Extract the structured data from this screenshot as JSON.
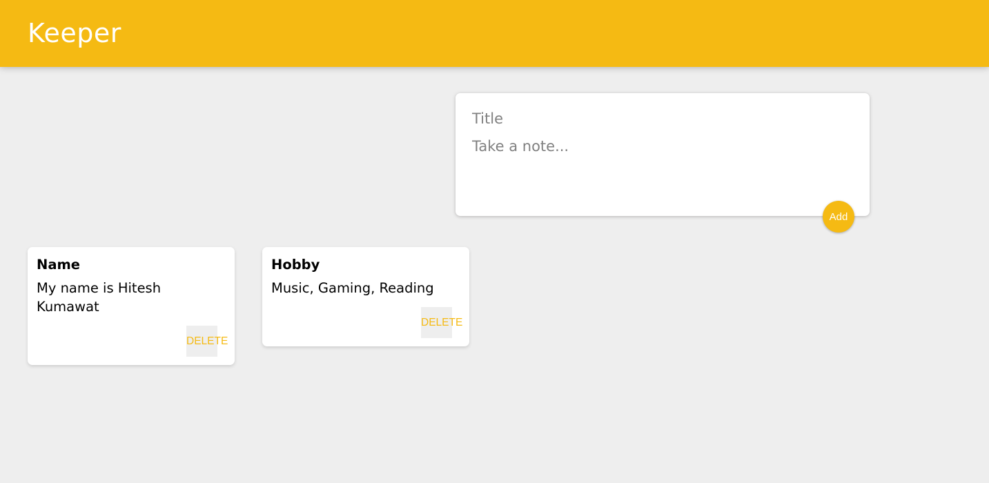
{
  "header": {
    "title": "Keeper"
  },
  "create_note": {
    "title_placeholder": "Title",
    "content_placeholder": "Take a note...",
    "add_label": "Add"
  },
  "notes": [
    {
      "title": "Name",
      "content": "My name is Hitesh\nKumawat",
      "delete_label": "DELETE"
    },
    {
      "title": "Hobby",
      "content": "Music, Gaming, Reading",
      "delete_label": "DELETE"
    }
  ],
  "colors": {
    "accent": "#f5ba13",
    "background": "#eeeeee",
    "card": "#ffffff"
  }
}
